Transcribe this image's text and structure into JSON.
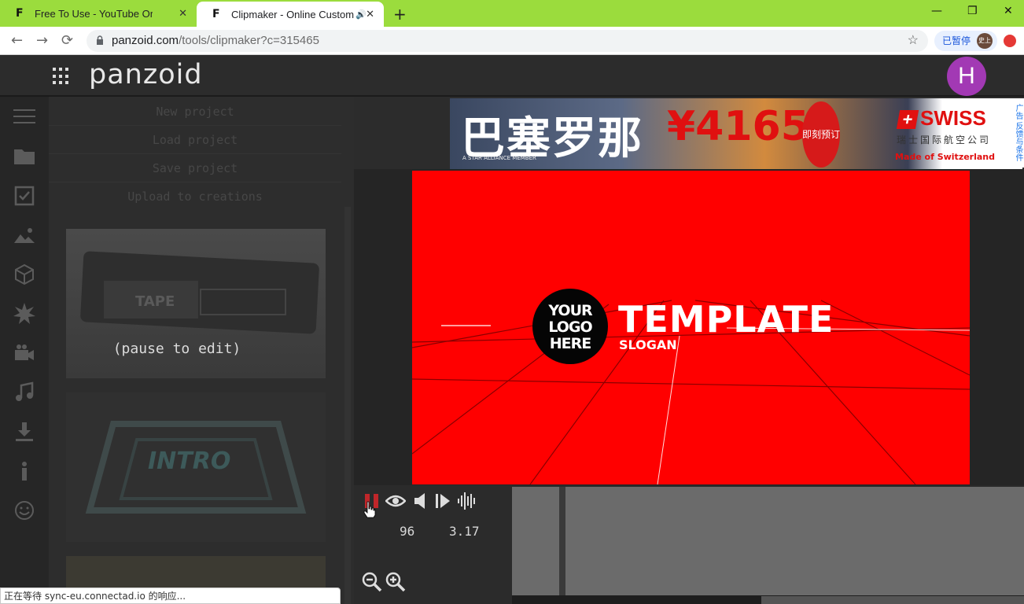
{
  "browser": {
    "tabs": [
      {
        "title": "Free To Use - YouTube Origina",
        "favicon": "panzoid-favicon",
        "close": "✕"
      },
      {
        "title": "Clipmaker - Online Custom",
        "favicon": "panzoid-favicon",
        "close": "✕",
        "audio": "🔊"
      }
    ],
    "new_tab": "+",
    "window_controls": {
      "minimize": "—",
      "maximize": "❐",
      "close": "✕"
    },
    "url_host": "panzoid.com",
    "url_path": "/tools/clipmaker?c=315465",
    "paused_label": "已暂停",
    "profile_mini": "史上"
  },
  "header": {
    "logo": "panzoid",
    "user_initial": "H"
  },
  "sidebar": {
    "icons": [
      "hamburger-icon",
      "folder-icon",
      "checkbox-icon",
      "image-icon",
      "cube-icon",
      "burst-icon",
      "camera-icon",
      "music-icon",
      "download-icon",
      "info-icon",
      "smiley-icon"
    ]
  },
  "menu": {
    "items": [
      "New project",
      "Load project",
      "Save project",
      "Upload to creations"
    ],
    "pause_message": "(pause to edit)",
    "thumb_labels": [
      "TAPE",
      "INTRO"
    ]
  },
  "ad": {
    "headline": "巴塞罗那",
    "price": "¥4165",
    "cta": "即刻预订",
    "member": "A STAR ALLIANCE MEMBER",
    "brand": "SWISS",
    "brand_sub": "瑞士国际航空公司",
    "tagline": "Made of Switzerland",
    "side": "广告 反馈与条件"
  },
  "preview": {
    "logo_text": [
      "YOUR",
      "LOGO",
      "HERE"
    ],
    "title": "TEMPLATE",
    "slogan": "SLOGAN"
  },
  "controls": {
    "frame_value": "96",
    "time_value": "3.17"
  },
  "status": {
    "text": "正在等待 sync-eu.connectad.io 的响应..."
  },
  "colors": {
    "tabstrip": "#9bdc3d",
    "avatar": "#a239b4",
    "canvas": "#ff0000",
    "pause_button": "#c0262a"
  }
}
